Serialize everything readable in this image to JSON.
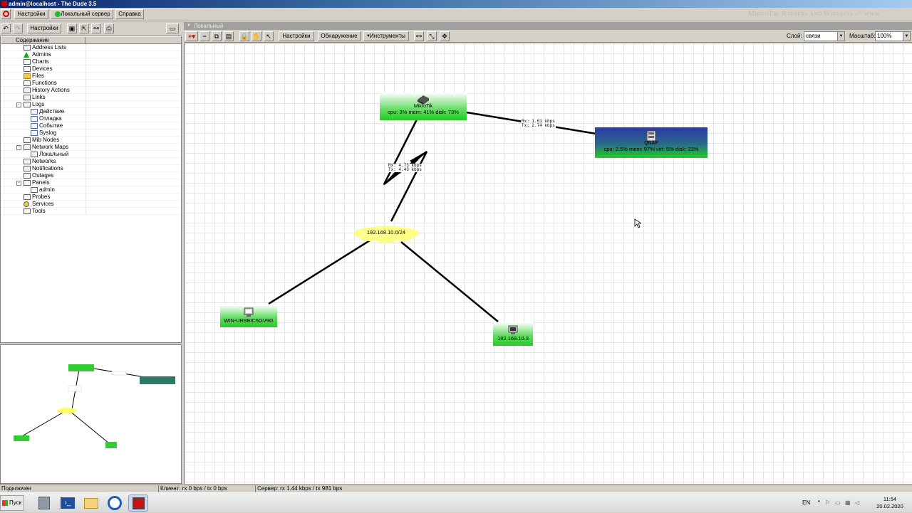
{
  "window": {
    "title": "admin@localhost - The Dude 3.5"
  },
  "menu": {
    "settings": "Настройки",
    "server": "Локальный сервер",
    "help": "Справка"
  },
  "brand": "MikroTik Routers and Wireless -> www",
  "left_toolbar": {
    "settings": "Настройки"
  },
  "tree": {
    "header": "Содержание",
    "items": [
      {
        "label": "Address Lists",
        "level": 1,
        "icon": "list-icon"
      },
      {
        "label": "Admins",
        "level": 1,
        "icon": "admin-icon"
      },
      {
        "label": "Charts",
        "level": 1,
        "icon": "list-icon"
      },
      {
        "label": "Devices",
        "level": 1,
        "icon": "list-icon"
      },
      {
        "label": "Files",
        "level": 1,
        "icon": "folder-icon"
      },
      {
        "label": "Functions",
        "level": 1,
        "icon": "list-icon"
      },
      {
        "label": "History Actions",
        "level": 1,
        "icon": "list-icon"
      },
      {
        "label": "Links",
        "level": 1,
        "icon": "list-icon"
      },
      {
        "label": "Logs",
        "level": 1,
        "icon": "list-icon",
        "expander": "-"
      },
      {
        "label": "Действие",
        "level": 2,
        "icon": "log-icon"
      },
      {
        "label": "Отладка",
        "level": 2,
        "icon": "log-icon"
      },
      {
        "label": "Событие",
        "level": 2,
        "icon": "log-icon"
      },
      {
        "label": "Syslog",
        "level": 2,
        "icon": "log-icon"
      },
      {
        "label": "Mib Nodes",
        "level": 1,
        "icon": "list-icon"
      },
      {
        "label": "Network Maps",
        "level": 1,
        "icon": "list-icon",
        "expander": "-"
      },
      {
        "label": "Локальный",
        "level": 2,
        "icon": "list-icon"
      },
      {
        "label": "Networks",
        "level": 1,
        "icon": "list-icon"
      },
      {
        "label": "Notifications",
        "level": 1,
        "icon": "list-icon"
      },
      {
        "label": "Outages",
        "level": 1,
        "icon": "list-icon"
      },
      {
        "label": "Panels",
        "level": 1,
        "icon": "list-icon",
        "expander": "-"
      },
      {
        "label": "admin",
        "level": 2,
        "icon": "list-icon"
      },
      {
        "label": "Probes",
        "level": 1,
        "icon": "list-icon"
      },
      {
        "label": "Services",
        "level": 1,
        "icon": "services-icon"
      },
      {
        "label": "Tools",
        "level": 1,
        "icon": "list-icon"
      }
    ]
  },
  "map_tab": "Локальный",
  "map_toolbar": {
    "settings": "Настройки",
    "discover": "Обнаружение",
    "tools": "Инструменты",
    "layer_label": "Слой:",
    "layer_value": "связи",
    "zoom_label": "Масштаб:",
    "zoom_value": "100%"
  },
  "devices": {
    "mikrotik": {
      "name": "MikroTik",
      "stats": "cpu: 3% mem: 41% disk: 73%"
    },
    "qnap": {
      "name": "QNAP",
      "stats": "cpu: 2.5% mem: 97% virt: 5% disk: 23%"
    },
    "network": {
      "name": "192.168.10.0/24"
    },
    "win": {
      "name": "WIN-UR9BIC5GV9G"
    },
    "host3": {
      "name": "192.168.10.3"
    }
  },
  "links": {
    "mikrotik_qnap": {
      "rx": "Rx: 1.61 kbps",
      "tx": "Tx: 2.74 kbps"
    },
    "mikrotik_net": {
      "rx": "Rx: 4.73 kbps",
      "tx": "Tx: 4.43 kbps"
    }
  },
  "status": {
    "connection": "Подключен",
    "client": "Клиент: rx 0 bps / tx 0 bps",
    "server": "Сервер: rx 1.44 kbps / tx 981 bps"
  },
  "taskbar": {
    "start": "Пуск",
    "lang": "EN",
    "time": "11:54",
    "date": "20.02.2020"
  },
  "colors": {
    "device_up": "#22cc22",
    "device_partial": "#2244aa",
    "network_cloud": "#ffff88",
    "titlebar": "#0a246a"
  }
}
